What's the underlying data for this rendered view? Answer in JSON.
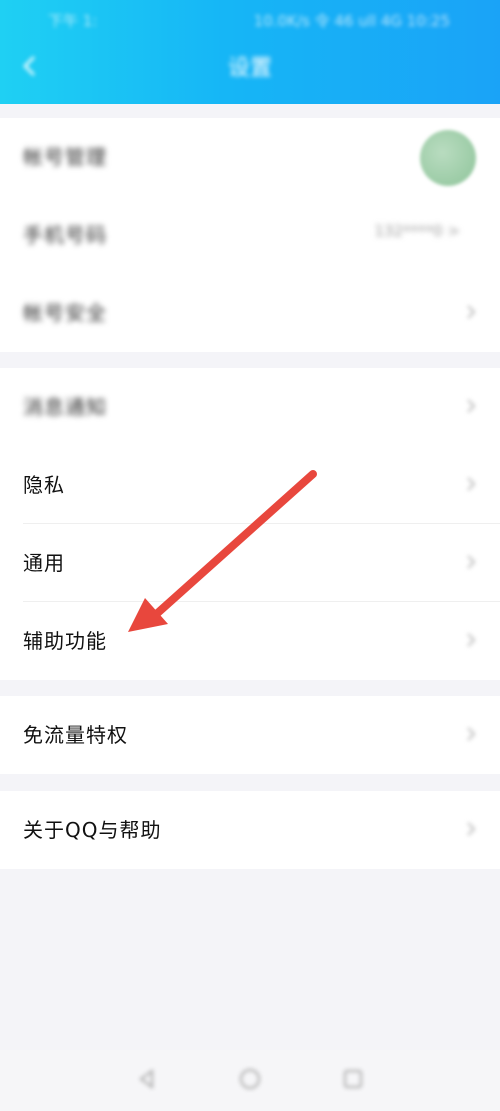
{
  "status_bar": {
    "time": "下午 1:",
    "right": "10.0K/s 令 46 ull 4G 10:25"
  },
  "header": {
    "title": "设置",
    "back_icon": "chevron-left-icon"
  },
  "groups": [
    {
      "items": [
        {
          "label": "帐号管理",
          "blurred": true,
          "has_avatar": true
        },
        {
          "label": "手机号码",
          "blurred": true,
          "value": "132****0 >"
        },
        {
          "label": "帐号安全",
          "blurred": true
        }
      ]
    },
    {
      "items": [
        {
          "label": "消息通知",
          "blurred": true
        },
        {
          "label": "隐私"
        },
        {
          "label": "通用"
        },
        {
          "label": "辅助功能"
        }
      ]
    },
    {
      "items": [
        {
          "label": "免流量特权"
        }
      ]
    },
    {
      "items": [
        {
          "label": "关于QQ与帮助"
        }
      ]
    }
  ],
  "annotation": {
    "color": "#e8473d",
    "points_to": "辅助功能"
  },
  "navbar": {
    "icons": [
      "back-triangle-icon",
      "home-circle-icon",
      "recents-square-icon"
    ]
  },
  "colors": {
    "header_gradient_start": "#1fd0f3",
    "header_gradient_end": "#1aa3f7",
    "background": "#f4f4f8"
  }
}
